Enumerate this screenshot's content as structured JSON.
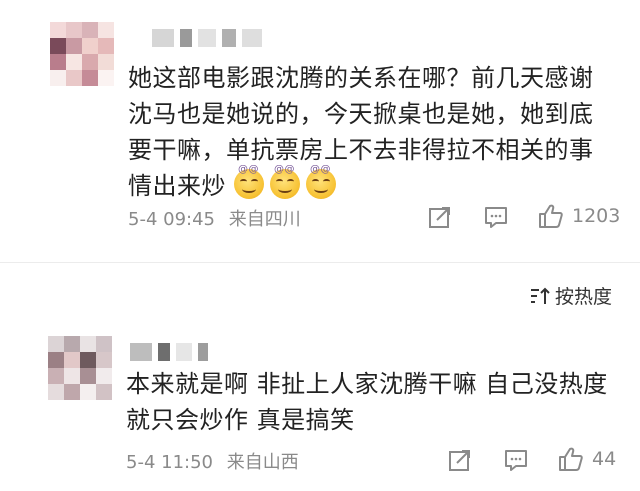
{
  "comments": [
    {
      "text_lines": [
        "她这部电影跟沈腾的关系在哪？前几天感谢",
        "沈马也是她说的，今天掀桌也是她，她到底",
        "要干嘛，单抗票房上不去非得拉不相关的事",
        "情出来炒"
      ],
      "time": "5-4 09:45",
      "location": "来自四川",
      "like_count": "1203",
      "emojis": [
        "dizzy-smirk-emoji",
        "dizzy-smirk-emoji",
        "dizzy-smirk-emoji"
      ]
    },
    {
      "text_lines": [
        "本来就是啊 非扯上人家沈腾干嘛 自己没热度",
        "就只会炒作 真是搞笑"
      ],
      "time": "5-4 11:50",
      "location": "来自山西",
      "like_count": "44"
    }
  ],
  "sort": {
    "label": "按热度",
    "icon": "sort-icon"
  },
  "icons": {
    "share": "share-icon",
    "comment": "comment-icon",
    "like": "thumbs-up-icon"
  }
}
